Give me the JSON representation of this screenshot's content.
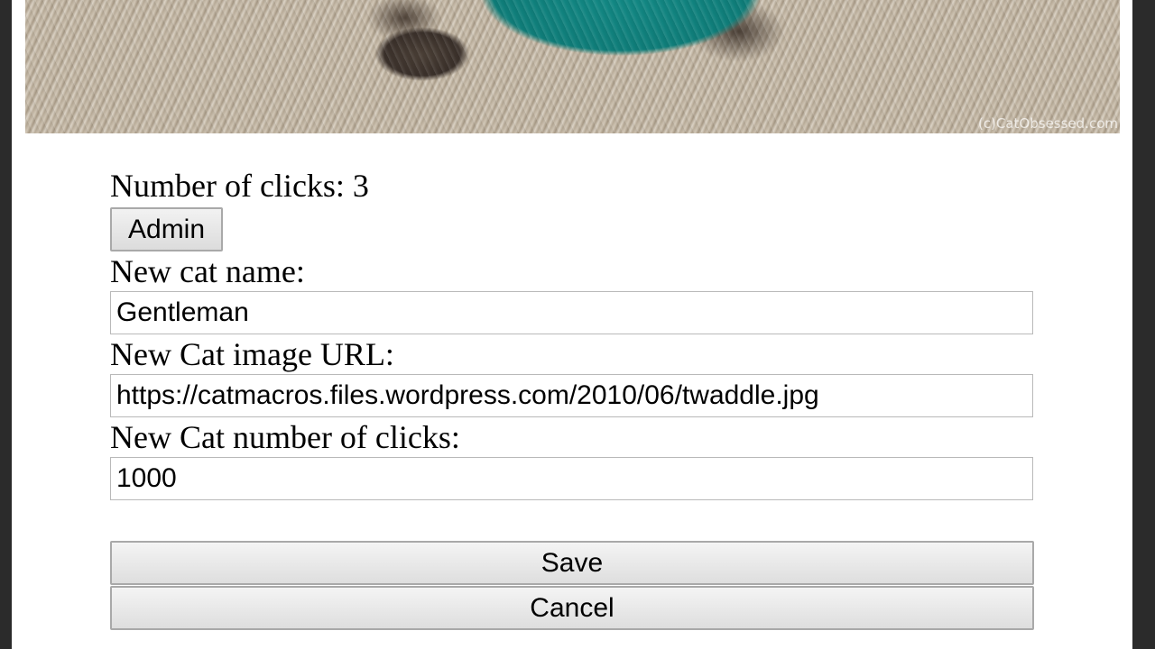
{
  "image": {
    "watermark": "(c)CatObsessed.com",
    "colors": {
      "costume": "#138a86",
      "costume_accent": "#e3c23a",
      "rug": "#bcb09e"
    }
  },
  "clicks": {
    "text": "Number of clicks: 3"
  },
  "admin": {
    "button_label": "Admin"
  },
  "form": {
    "name_label": "New cat name:",
    "name_value": "Gentleman",
    "url_label": "New Cat image URL:",
    "url_value": "https://catmacros.files.wordpress.com/2010/06/twaddle.jpg",
    "clicks_label": "New Cat number of clicks:",
    "clicks_value": "1000",
    "save_label": "Save",
    "cancel_label": "Cancel"
  }
}
